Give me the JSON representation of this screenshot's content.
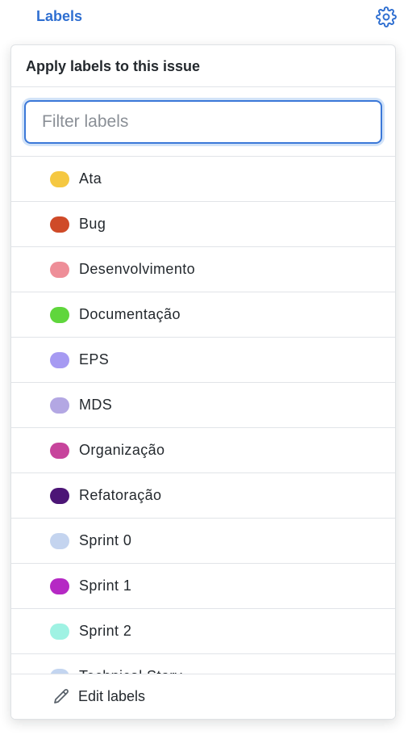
{
  "header": {
    "title": "Labels",
    "settings_icon": "gear-icon",
    "accent": "#2f6fd1"
  },
  "panel": {
    "title": "Apply labels to this issue",
    "filter": {
      "placeholder": "Filter labels",
      "value": ""
    },
    "labels": [
      {
        "name": "Ata",
        "color": "#f5c842"
      },
      {
        "name": "Bug",
        "color": "#cf4a28"
      },
      {
        "name": "Desenvolvimento",
        "color": "#ee8e98"
      },
      {
        "name": "Documentação",
        "color": "#5fd63c"
      },
      {
        "name": "EPS",
        "color": "#a69af2"
      },
      {
        "name": "MDS",
        "color": "#b3a7e3"
      },
      {
        "name": "Organização",
        "color": "#c7449c"
      },
      {
        "name": "Refatoração",
        "color": "#4c1576"
      },
      {
        "name": "Sprint 0",
        "color": "#c4d4ef"
      },
      {
        "name": "Sprint 1",
        "color": "#b529c4"
      },
      {
        "name": "Sprint 2",
        "color": "#9ff2e3"
      },
      {
        "name": "Technical Story",
        "color": "#c3d5f0"
      }
    ],
    "footer": {
      "label": "Edit labels",
      "icon": "pencil-icon"
    }
  }
}
